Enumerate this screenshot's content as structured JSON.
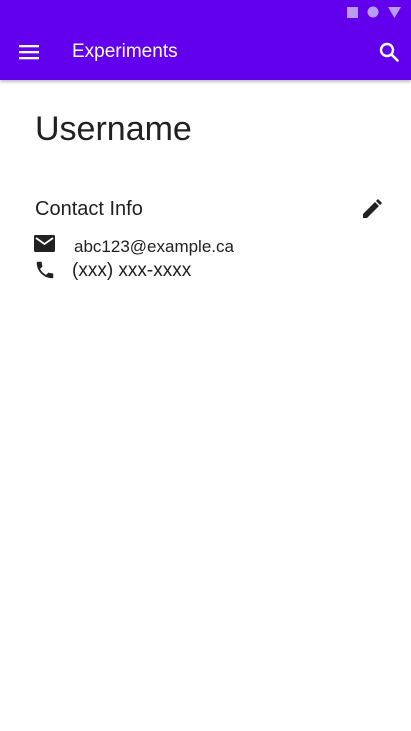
{
  "app_bar": {
    "title": "Experiments",
    "menu_icon": "menu-icon",
    "search_icon": "search-icon",
    "color": "#6200ee"
  },
  "status_bar": {
    "icons": [
      "square-icon",
      "circle-icon",
      "triangle-icon"
    ]
  },
  "profile": {
    "username": "Username"
  },
  "contact": {
    "section_title": "Contact Info",
    "edit_icon": "edit-icon",
    "email_icon": "mail-icon",
    "email": "abc123@example.ca",
    "phone_icon": "phone-icon",
    "phone": "(xxx) xxx-xxxx"
  }
}
